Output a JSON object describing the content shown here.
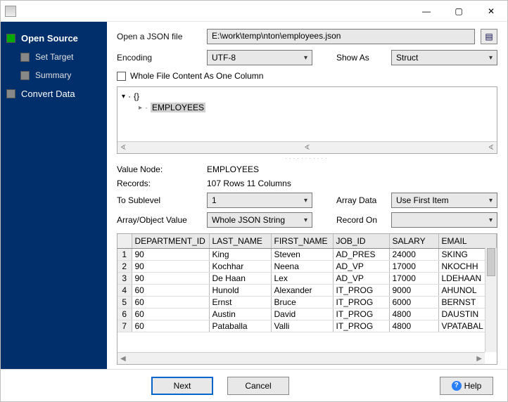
{
  "titlebar": {
    "title": ""
  },
  "sidebar": {
    "items": [
      {
        "label": "Open Source",
        "active": true,
        "sub": false
      },
      {
        "label": "Set Target",
        "active": false,
        "sub": true
      },
      {
        "label": "Summary",
        "active": false,
        "sub": true
      },
      {
        "label": "Convert Data",
        "active": false,
        "sub": false
      }
    ]
  },
  "form": {
    "open_label": "Open a JSON file",
    "file_path": "E:\\work\\temp\\nton\\employees.json",
    "encoding_label": "Encoding",
    "encoding_value": "UTF-8",
    "showas_label": "Show As",
    "showas_value": "Struct",
    "whole_file_cb": "Whole File Content As One Column",
    "whole_file_checked": false
  },
  "tree": {
    "root_symbol": "{}",
    "selected": "EMPLOYEES"
  },
  "meta": {
    "value_node_label": "Value Node:",
    "value_node": "EMPLOYEES",
    "records_label": "Records:",
    "records": "107 Rows    11 Columns",
    "sublevel_label": "To Sublevel",
    "sublevel_value": "1",
    "arraydata_label": "Array Data",
    "arraydata_value": "Use First Item",
    "arrobj_label": "Array/Object Value",
    "arrobj_value": "Whole JSON String",
    "recordon_label": "Record On",
    "recordon_value": ""
  },
  "table": {
    "columns": [
      "DEPARTMENT_ID",
      "LAST_NAME",
      "FIRST_NAME",
      "JOB_ID",
      "SALARY",
      "EMAIL"
    ],
    "rows": [
      [
        "90",
        "King",
        "Steven",
        "AD_PRES",
        "24000",
        "SKING"
      ],
      [
        "90",
        "Kochhar",
        "Neena",
        "AD_VP",
        "17000",
        "NKOCHH"
      ],
      [
        "90",
        "De Haan",
        "Lex",
        "AD_VP",
        "17000",
        "LDEHAAN"
      ],
      [
        "60",
        "Hunold",
        "Alexander",
        "IT_PROG",
        "9000",
        "AHUNOL"
      ],
      [
        "60",
        "Ernst",
        "Bruce",
        "IT_PROG",
        "6000",
        "BERNST"
      ],
      [
        "60",
        "Austin",
        "David",
        "IT_PROG",
        "4800",
        "DAUSTIN"
      ],
      [
        "60",
        "Pataballa",
        "Valli",
        "IT_PROG",
        "4800",
        "VPATABAL"
      ]
    ]
  },
  "footer": {
    "next": "Next",
    "cancel": "Cancel",
    "help": "Help"
  }
}
